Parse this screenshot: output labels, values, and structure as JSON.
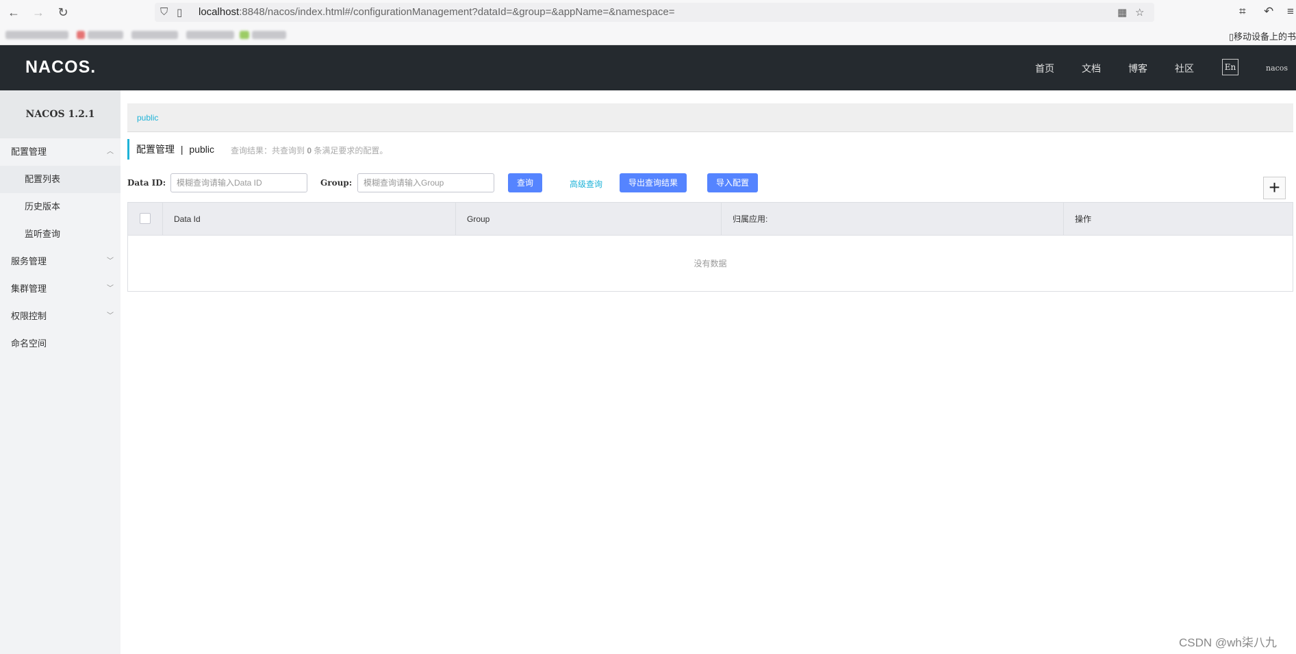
{
  "browser": {
    "url_host": "localhost",
    "url_rest": ":8848/nacos/index.html#/configurationManagement?dataId=&group=&appName=&namespace=",
    "bookmark_right": "移动设备上的书"
  },
  "header": {
    "logo": "NACOS.",
    "nav": [
      "首页",
      "文档",
      "博客",
      "社区"
    ],
    "lang": "En",
    "user": "nacos"
  },
  "sidebar": {
    "title": "NACOS 1.2.1",
    "items": [
      {
        "label": "配置管理"
      },
      {
        "label": "配置列表"
      },
      {
        "label": "历史版本"
      },
      {
        "label": "监听查询"
      },
      {
        "label": "服务管理"
      },
      {
        "label": "集群管理"
      },
      {
        "label": "权限控制"
      },
      {
        "label": "命名空间"
      }
    ]
  },
  "main": {
    "namespace_tab": "public",
    "title": "配置管理",
    "separator": "|",
    "namespace": "public",
    "query_result_prefix": "查询结果：共查询到",
    "query_result_count": "0",
    "query_result_suffix": "条满足要求的配置。",
    "filters": {
      "data_id_label": "Data ID:",
      "data_id_placeholder": "模糊查询请输入Data ID",
      "group_label": "Group:",
      "group_placeholder": "模糊查询请输入Group"
    },
    "buttons": {
      "search": "查询",
      "advanced": "高级查询",
      "export": "导出查询结果",
      "import": "导入配置",
      "add": "+"
    },
    "table": {
      "columns": [
        "Data Id",
        "Group",
        "归属应用:",
        "操作"
      ],
      "empty": "没有数据"
    }
  },
  "watermark": "CSDN @wh柒八九"
}
